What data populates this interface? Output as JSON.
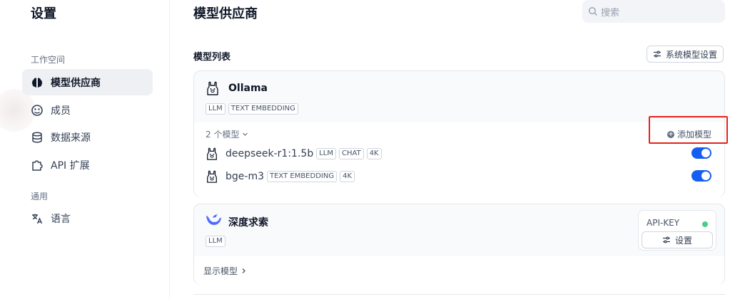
{
  "sidebar": {
    "title": "设置",
    "groups": [
      {
        "label": "工作空间"
      },
      {
        "label": "通用"
      }
    ],
    "items": [
      {
        "label": "模型供应商",
        "icon": "brain-icon",
        "active": true
      },
      {
        "label": "成员",
        "icon": "members-icon",
        "active": false
      },
      {
        "label": "数据来源",
        "icon": "database-icon",
        "active": false
      },
      {
        "label": "API 扩展",
        "icon": "puzzle-icon",
        "active": false
      },
      {
        "label": "语言",
        "icon": "translate-icon",
        "active": false
      }
    ]
  },
  "header": {
    "title": "模型供应商",
    "search_placeholder": "搜索"
  },
  "model_list": {
    "title": "模型列表",
    "system_settings_label": "系统模型设置"
  },
  "providers": [
    {
      "name": "Ollama",
      "tags": [
        "LLM",
        "TEXT EMBEDDING"
      ],
      "model_count_label": "2 个模型",
      "add_model_label": "添加模型",
      "models": [
        {
          "name": "deepseek-r1:1.5b",
          "tags": [
            "LLM",
            "CHAT",
            "4K"
          ],
          "enabled": true
        },
        {
          "name": "bge-m3",
          "tags": [
            "TEXT EMBEDDING",
            "4K"
          ],
          "enabled": true
        }
      ]
    },
    {
      "name": "深度求索",
      "tags": [
        "LLM"
      ],
      "api_key_label": "API-KEY",
      "api_key_status_color": "#47cd89",
      "settings_label": "设置",
      "show_models_label": "显示模型"
    }
  ],
  "colors": {
    "accent": "#155eef",
    "highlight_box": "#e8221b"
  }
}
